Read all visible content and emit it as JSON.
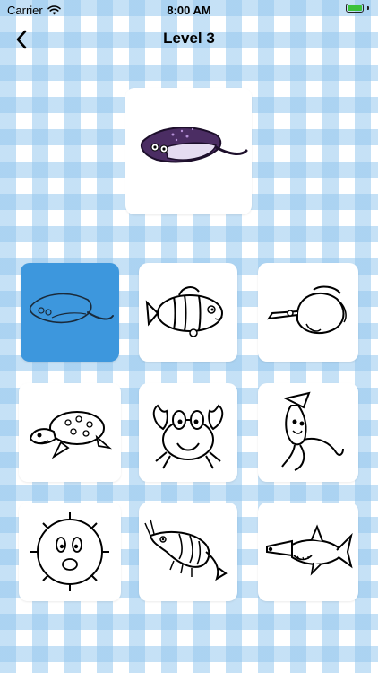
{
  "status_bar": {
    "carrier": "Carrier",
    "time": "8:00 AM"
  },
  "nav": {
    "title": "Level 3",
    "back_icon": "chevron-left-icon"
  },
  "preview": {
    "icon": "stingray-colored-icon"
  },
  "grid": {
    "selected_index": 0,
    "items": [
      {
        "icon": "stingray-outline-icon"
      },
      {
        "icon": "clownfish-outline-icon"
      },
      {
        "icon": "butterflyfish-outline-icon"
      },
      {
        "icon": "sea-turtle-outline-icon"
      },
      {
        "icon": "crab-outline-icon"
      },
      {
        "icon": "squid-outline-icon"
      },
      {
        "icon": "pufferfish-outline-icon"
      },
      {
        "icon": "shrimp-outline-icon"
      },
      {
        "icon": "hammerhead-shark-outline-icon"
      }
    ]
  },
  "colors": {
    "selected": "#3d97dd",
    "stingray_purple": "#4b2d63",
    "stingray_belly": "#e5dcf1"
  }
}
